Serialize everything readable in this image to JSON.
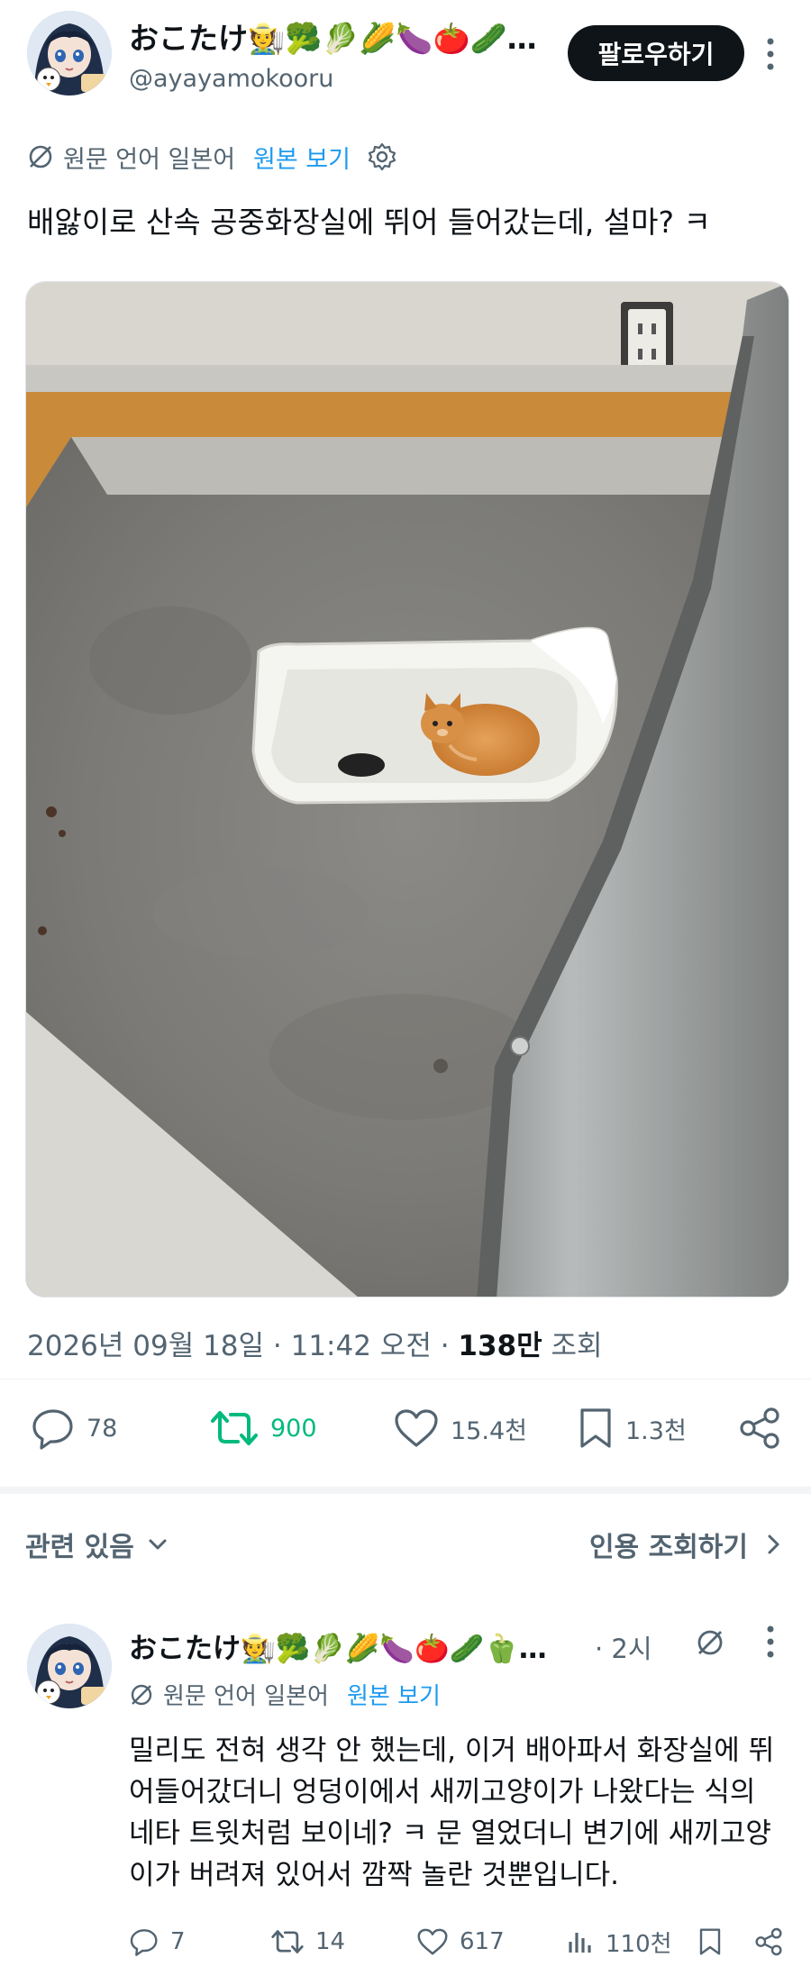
{
  "post": {
    "display_name": "おこたけ🧑‍🌾🥦🥬🌽🍆🍅🥒…",
    "handle": "@ayayamokooru",
    "follow_label": "팔로우하기",
    "translated_from": "원문 언어 일본어",
    "show_original": "원본 보기",
    "text": "배앓이로 산속 공중화장실에 뛰어 들어갔는데, 설마? ㅋ",
    "date": "2026년 09월 18일 · 11:42 오전 · ",
    "views_count": "138만",
    "views_label": " 조회",
    "replies": "78",
    "reposts": "900",
    "likes": "15.4천",
    "bookmarks": "1.3천"
  },
  "related": {
    "label": "관련 있음",
    "quotes_label": "인용 조회하기"
  },
  "reply": {
    "display_name": "おこたけ🧑‍🌾🥦🥬🌽🍆🍅🥒🫑…",
    "time": "· 2시",
    "translated_from": "원문 언어 일본어",
    "show_original": "원본 보기",
    "text": "밀리도 전혀 생각 안 했는데, 이거 배아파서 화장실에 뛰어들어갔더니 엉덩이에서 새끼고양이가 나왔다는 식의 네타 트윗처럼 보이네? ㅋ 문 열었더니 변기에 새끼고양이가 버려져 있어서 깜짝 놀란 것뿐입니다.",
    "replies": "7",
    "reposts": "14",
    "likes": "617",
    "views": "110천"
  },
  "colors": {
    "accent": "#1d9bf0",
    "repost_green": "#00ba7c",
    "secondary_text": "#536471",
    "primary_text": "#0f1419"
  }
}
